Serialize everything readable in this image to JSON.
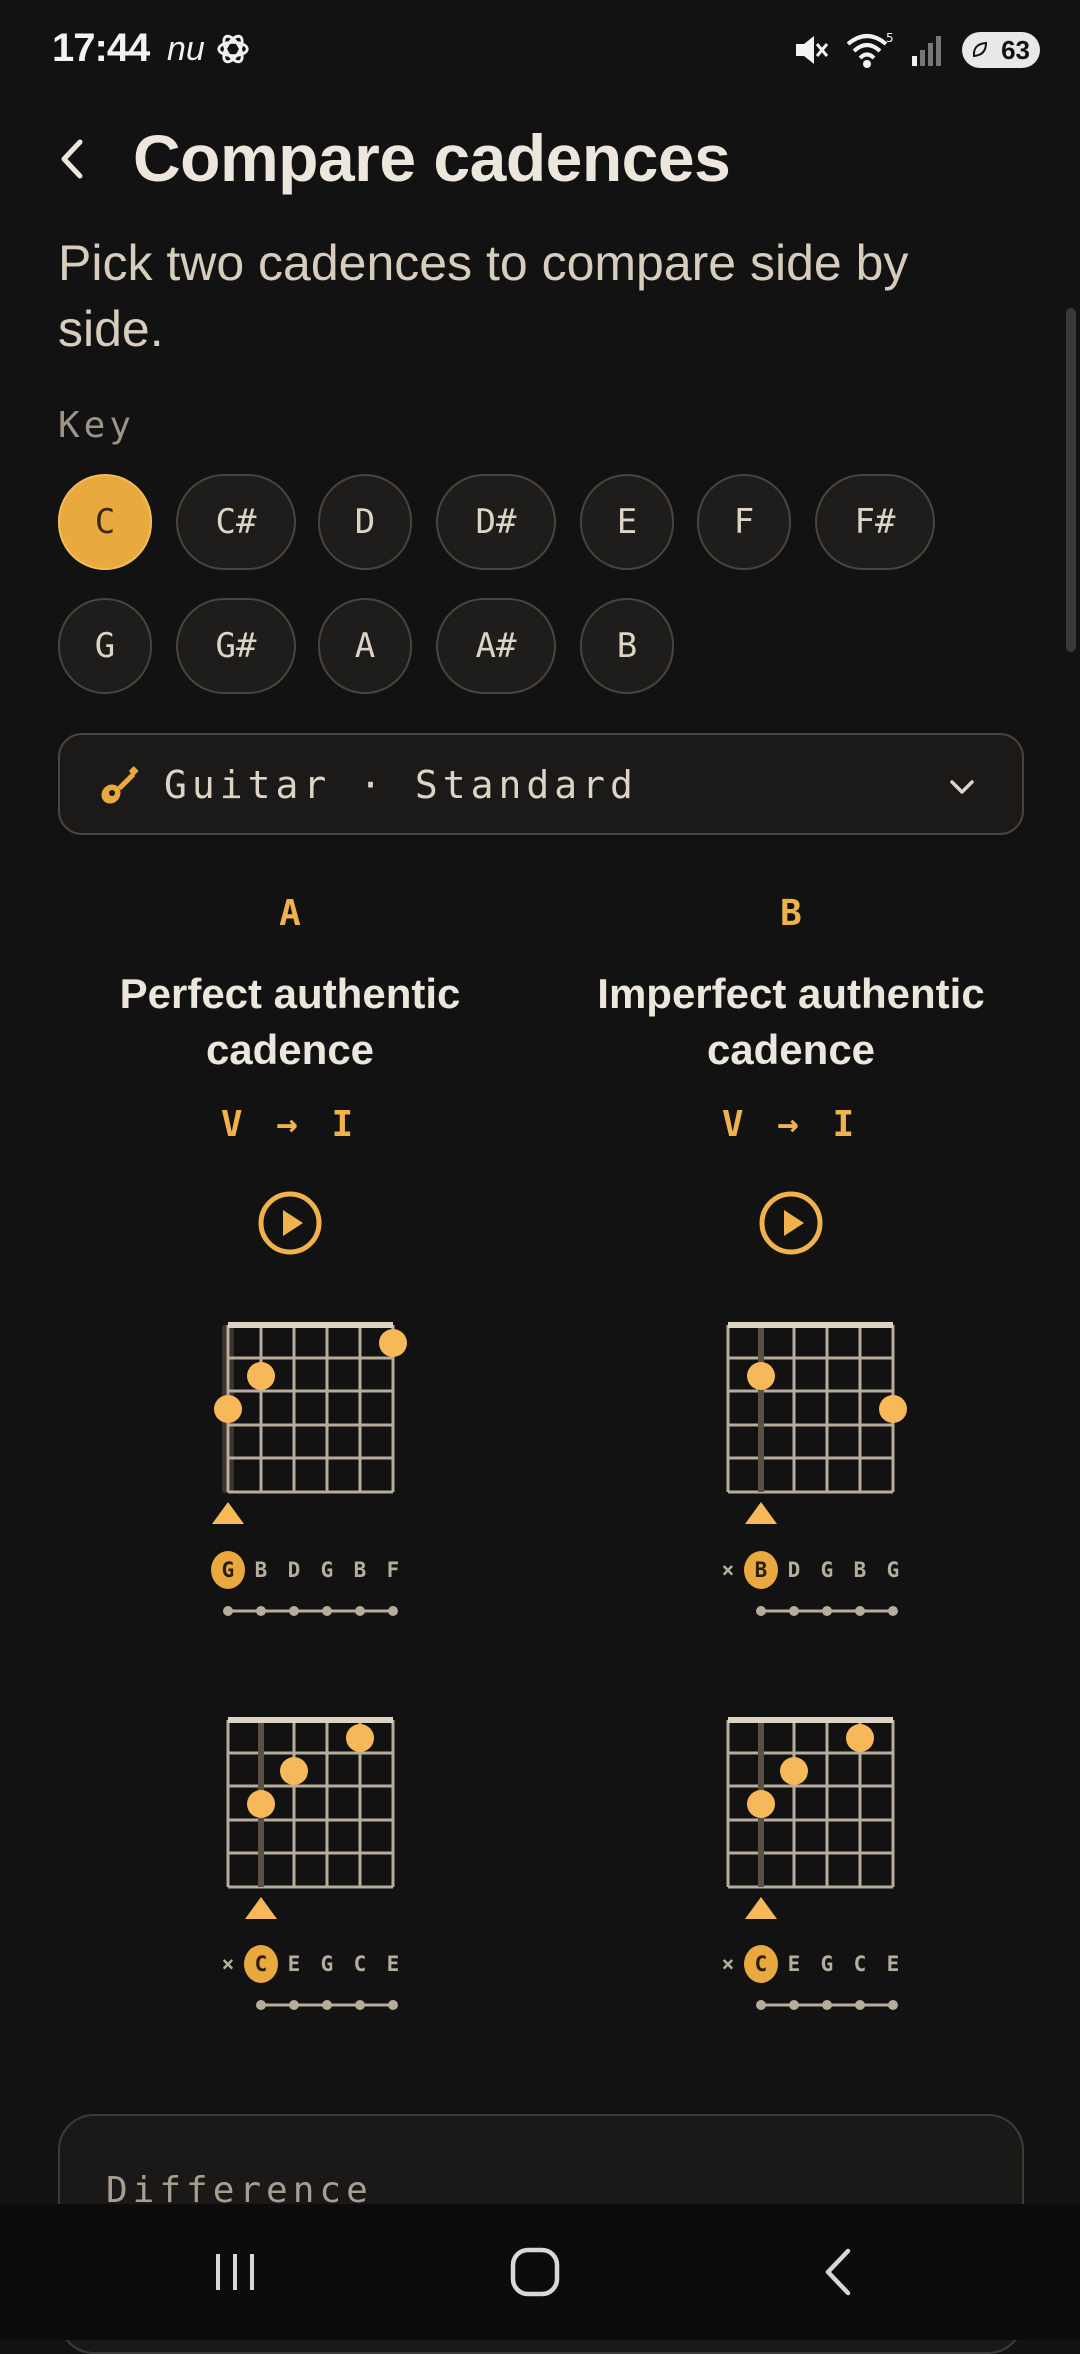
{
  "status_bar": {
    "time": "17:44",
    "carrier": "nu",
    "battery": "63"
  },
  "header": {
    "title": "Compare cadences"
  },
  "subtitle": "Pick two cadences to compare side by side.",
  "key_section": {
    "label": "Key",
    "keys": [
      "C",
      "C#",
      "D",
      "D#",
      "E",
      "F",
      "F#",
      "G",
      "G#",
      "A",
      "A#",
      "B"
    ],
    "selected": "C"
  },
  "instrument": {
    "icon": "guitar-icon",
    "label": "Guitar · Standard"
  },
  "columns": [
    {
      "letter": "A",
      "name": "Perfect authentic cadence",
      "progression": "V → I",
      "chords": [
        {
          "strings": [
            "G",
            "B",
            "D",
            "G",
            "B",
            "F"
          ],
          "root_index": 0
        },
        {
          "strings": [
            "×",
            "C",
            "E",
            "G",
            "C",
            "E"
          ],
          "root_index": 1
        }
      ]
    },
    {
      "letter": "B",
      "name": "Imperfect authentic cadence",
      "progression": "V → I",
      "chords": [
        {
          "strings": [
            "×",
            "B",
            "D",
            "G",
            "B",
            "G"
          ],
          "root_index": 1
        },
        {
          "strings": [
            "×",
            "C",
            "E",
            "G",
            "C",
            "E"
          ],
          "root_index": 1
        }
      ]
    }
  ],
  "difference": {
    "title": "Difference"
  },
  "colors": {
    "accent": "#eaa93f",
    "background": "#121212",
    "text": "#ece6dc"
  }
}
